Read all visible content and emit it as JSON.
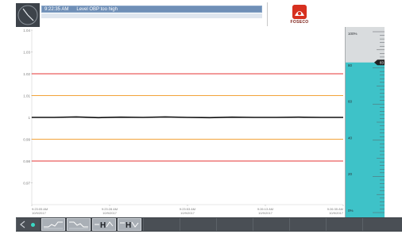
{
  "header": {
    "alarm_time": "9:22:35 AM",
    "alarm_text": "Level OBP too high",
    "logo_text": "FOSECO",
    "clock_icon": "clock-icon"
  },
  "chart_data": {
    "type": "line",
    "y_ticks": [
      "1.04",
      "1.03",
      "1.02",
      "1.01",
      "1",
      "0.99",
      "0.98",
      "0.97"
    ],
    "ylim": [
      0.96,
      1.04
    ],
    "x_ticks": [
      {
        "time": "9:23:05 AM",
        "date": "10/9/2017"
      },
      {
        "time": "9:23:28 AM",
        "date": "10/9/2017"
      },
      {
        "time": "9:23:53 AM",
        "date": "10/9/2017"
      },
      {
        "time": "9:26:13 AM",
        "date": "10/9/2017"
      },
      {
        "time": "9:26:35 AM",
        "date": "10/9/2017"
      }
    ],
    "limits": [
      {
        "name": "high-alarm",
        "value": 1.02,
        "color": "#e43535"
      },
      {
        "name": "high-warning",
        "value": 1.01,
        "color": "#f2a33a"
      },
      {
        "name": "low-warning",
        "value": 0.99,
        "color": "#f2a33a"
      },
      {
        "name": "low-alarm",
        "value": 0.98,
        "color": "#e43535"
      }
    ],
    "series": [
      {
        "color": "#111111",
        "values": [
          1.0,
          1.0,
          1.0002,
          0.9999,
          1.0001,
          1.0,
          1.0002,
          1.0,
          0.9999,
          1.0001,
          1.0,
          1.0,
          1.0001,
          1.0,
          1.0
        ]
      }
    ],
    "grid": false
  },
  "gauge": {
    "ticks": [
      "100%",
      "80",
      "60",
      "40",
      "20",
      "0%"
    ],
    "value": 83,
    "value_label": "83",
    "fill_color": "#3ec2c8",
    "pointer_color": "#222222"
  },
  "taskbar": {
    "buttons": [
      "trend-view-1",
      "trend-view-2",
      "hold-trend-1",
      "hold-trend-2"
    ]
  }
}
